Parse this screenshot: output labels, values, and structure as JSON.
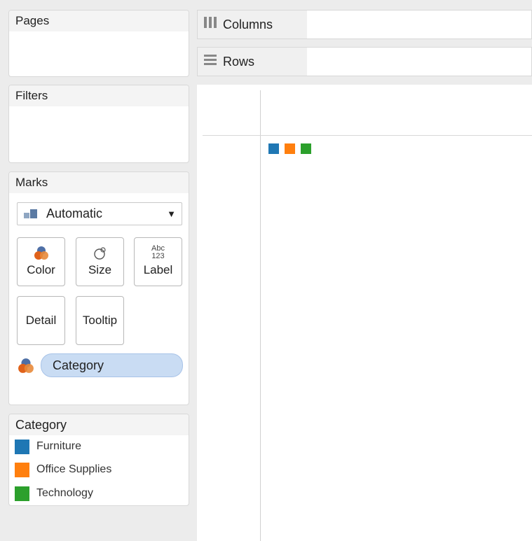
{
  "panels": {
    "pages": "Pages",
    "filters": "Filters",
    "marks": "Marks"
  },
  "shelves": {
    "columns": "Columns",
    "rows": "Rows"
  },
  "marks_card": {
    "mark_type": "Automatic",
    "buttons": {
      "color": "Color",
      "size": "Size",
      "label": "Label",
      "label_icon_top": "Abc",
      "label_icon_bottom": "123",
      "detail": "Detail",
      "tooltip": "Tooltip"
    },
    "color_field": "Category"
  },
  "legend": {
    "title": "Category",
    "items": [
      {
        "label": "Furniture",
        "color": "#1f77b4"
      },
      {
        "label": "Office Supplies",
        "color": "#ff7f0e"
      },
      {
        "label": "Technology",
        "color": "#2ca02c"
      }
    ]
  },
  "view": {
    "mark_colors": [
      "#1f77b4",
      "#ff7f0e",
      "#2ca02c"
    ]
  }
}
